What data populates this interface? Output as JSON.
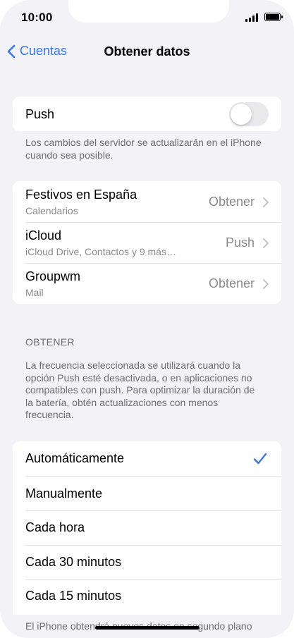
{
  "status_bar": {
    "time": "10:00"
  },
  "nav": {
    "back_label": "Cuentas",
    "title": "Obtener datos"
  },
  "push": {
    "label": "Push",
    "enabled": false,
    "footnote": "Los cambios del servidor se actualizarán en el iPhone cuando sea posible."
  },
  "accounts": [
    {
      "name": "Festivos en España",
      "subtitle": "Calendarios",
      "value": "Obtener"
    },
    {
      "name": "iCloud",
      "subtitle": "iCloud Drive, Contactos y 9 más…",
      "value": "Push"
    },
    {
      "name": "Groupwm",
      "subtitle": "Mail",
      "value": "Obtener"
    }
  ],
  "fetch": {
    "header": "OBTENER",
    "description": "La frecuencia seleccionada se utilizará cuando la opción Push esté desactivada, o en aplicaciones no compatibles con push. Para optimizar la duración de la batería, obtén actualizaciones con menos frecuencia.",
    "options": [
      {
        "label": "Automáticamente",
        "selected": true
      },
      {
        "label": "Manualmente",
        "selected": false
      },
      {
        "label": "Cada hora",
        "selected": false
      },
      {
        "label": "Cada 30 minutos",
        "selected": false
      },
      {
        "label": "Cada 15 minutos",
        "selected": false
      }
    ],
    "footnote_partial": "El iPhone obtendrá nuevos datos en segundo plano"
  },
  "colors": {
    "accent": "#3478f6",
    "background": "#f2f2f7",
    "secondary_text": "#8a8a8e"
  }
}
